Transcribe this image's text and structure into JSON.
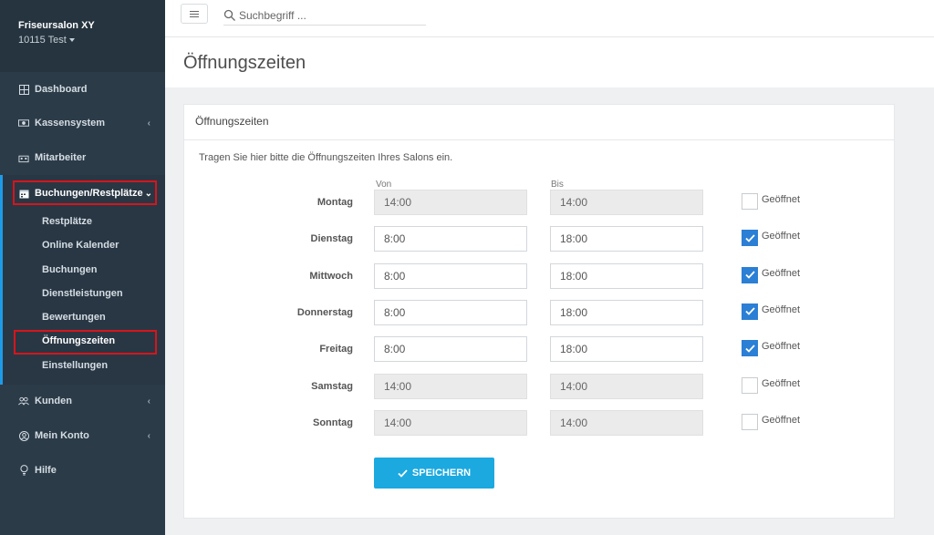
{
  "sidebar": {
    "brand_name": "Friseursalon XY",
    "brand_sub": "10115 Test",
    "items": [
      {
        "label": "Dashboard",
        "icon": "grid-icon"
      },
      {
        "label": "Kassensystem",
        "icon": "cash-icon"
      },
      {
        "label": "Mitarbeiter",
        "icon": "team-icon"
      },
      {
        "label": "Buchungen/Restplätze",
        "icon": "calendar-icon"
      },
      {
        "label": "Kunden",
        "icon": "users-icon"
      },
      {
        "label": "Mein Konto",
        "icon": "user-circle-icon"
      },
      {
        "label": "Hilfe",
        "icon": "lightbulb-icon"
      }
    ],
    "subitems": [
      {
        "label": "Restplätze"
      },
      {
        "label": "Online Kalender"
      },
      {
        "label": "Buchungen"
      },
      {
        "label": "Dienstleistungen"
      },
      {
        "label": "Bewertungen"
      },
      {
        "label": "Öffnungszeiten"
      },
      {
        "label": "Einstellungen"
      }
    ],
    "highlight_color": "#d6151c",
    "active_accent": "#1e9be8"
  },
  "topbar": {
    "search_placeholder": "Suchbegriff ..."
  },
  "page": {
    "title": "Öffnungszeiten"
  },
  "card": {
    "header": "Öffnungszeiten",
    "intro": "Tragen Sie hier bitte die Öffnungszeiten Ihres Salons ein.",
    "col_from": "Von",
    "col_to": "Bis",
    "open_label": "Geöffnet",
    "days": [
      {
        "name": "Montag",
        "from": "14:00",
        "to": "14:00",
        "open": false
      },
      {
        "name": "Dienstag",
        "from": "8:00",
        "to": "18:00",
        "open": true
      },
      {
        "name": "Mittwoch",
        "from": "8:00",
        "to": "18:00",
        "open": true
      },
      {
        "name": "Donnerstag",
        "from": "8:00",
        "to": "18:00",
        "open": true
      },
      {
        "name": "Freitag",
        "from": "8:00",
        "to": "18:00",
        "open": true
      },
      {
        "name": "Samstag",
        "from": "14:00",
        "to": "14:00",
        "open": false
      },
      {
        "name": "Sonntag",
        "from": "14:00",
        "to": "14:00",
        "open": false
      }
    ],
    "save_label": "SPEICHERN",
    "save_color": "#1ba9e0",
    "check_color": "#2b7fd4"
  }
}
